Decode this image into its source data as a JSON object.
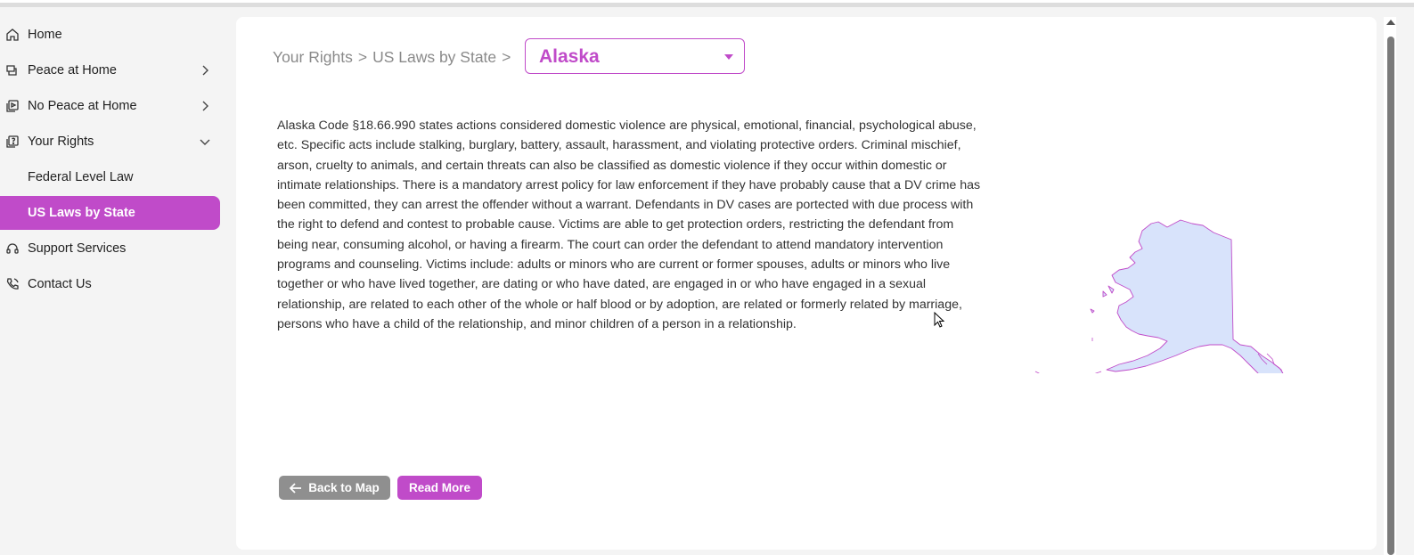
{
  "sidebar": {
    "items": [
      {
        "label": "Home",
        "icon": "home-icon"
      },
      {
        "label": "Peace at Home",
        "icon": "peace-icon"
      },
      {
        "label": "No Peace at Home",
        "icon": "no-peace-icon"
      },
      {
        "label": "Your Rights",
        "icon": "rights-icon"
      }
    ],
    "sub_items": [
      {
        "label": "Federal Level Law"
      },
      {
        "label": "US Laws by State"
      }
    ],
    "items_after": [
      {
        "label": "Support Services",
        "icon": "support-icon"
      },
      {
        "label": "Contact Us",
        "icon": "phone-icon"
      }
    ]
  },
  "breadcrumb": {
    "part1": "Your Rights",
    "sep1": ">",
    "part2": "US Laws by State",
    "sep2": ">"
  },
  "state_select": {
    "value": "Alaska"
  },
  "law_text": "Alaska Code §18.66.990 states actions considered domestic violence are physical, emotional, financial, psychological abuse, etc. Specific acts include stalking, burglary, battery, assault, harassment, and violating protective orders. Criminal mischief, arson, cruelty to animals, and certain threats can also be classified as domestic violence if they occur within domestic or intimate relationships. There is a mandatory arrest policy for law enforcement if they have probably cause that a DV crime has been committed, they can arrest the offender without a warrant. Defendants in DV cases are portected with due process with the right to defend and contest to probable cause. Victims are able to get protection orders, restricting the defendant from being near, consuming alcohol, or having a firearm. The court can order the defendant to attend mandatory intervention programs and counseling. Victims include: adults or minors who are current or former spouses, adults or minors who live together or who have lived together, are dating or who have dated, are engaged in or who have engaged in a sexual relationship, are related to each other of the whole or half blood or by adoption, are related or formerly related by marriage, persons who have a child of the relationship, and minor children of a person in a relationship.",
  "buttons": {
    "back": "Back to Map",
    "read_more": "Read More"
  },
  "colors": {
    "accent": "#c04bc9",
    "map_fill": "#d8e3fb",
    "back_button": "#8f8f8f"
  }
}
